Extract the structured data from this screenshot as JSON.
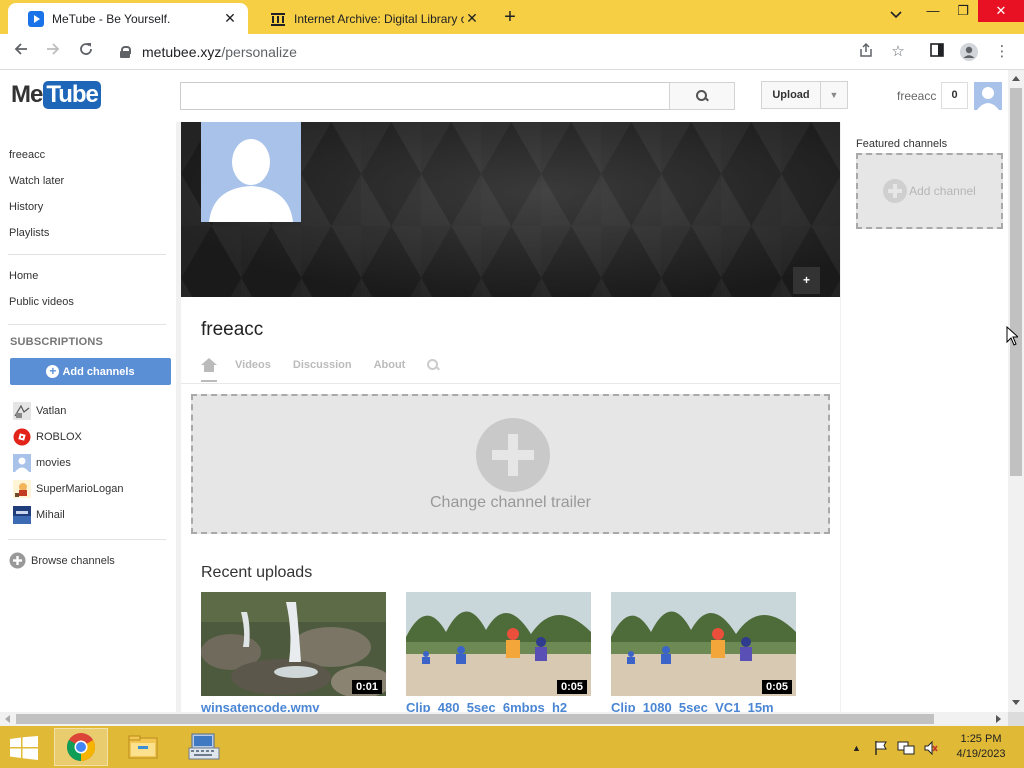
{
  "browser": {
    "tabs": [
      {
        "title": "MeTube - Be Yourself.",
        "active": true
      },
      {
        "title": "Internet Archive: Digital Library o",
        "active": false
      }
    ],
    "url_host": "metubee.xyz",
    "url_path": "/personalize"
  },
  "header": {
    "logo_me": "Me",
    "logo_tube": "Tube",
    "search_placeholder": "",
    "upload_label": "Upload",
    "username": "freeacc",
    "notification_count": "0"
  },
  "sidebar": {
    "top_items": [
      "freeacc",
      "Watch later",
      "History",
      "Playlists"
    ],
    "nav_items": [
      "Home",
      "Public videos"
    ],
    "subscriptions_heading": "SUBSCRIPTIONS",
    "add_channels_label": "Add channels",
    "subscriptions": [
      "Vatlan",
      "ROBLOX",
      "movies",
      "SuperMarioLogan",
      "Mihail"
    ],
    "browse_channels_label": "Browse channels"
  },
  "channel": {
    "name": "freeacc",
    "tabs": [
      "Videos",
      "Discussion",
      "About"
    ],
    "banner_edit_label": "+",
    "trailer_label": "Change channel trailer",
    "recent_uploads_title": "Recent uploads",
    "videos": [
      {
        "title": "winsatencode.wmv",
        "duration": "0:01"
      },
      {
        "title": "Clip_480_5sec_6mbps_h2",
        "duration": "0:05"
      },
      {
        "title": "Clip_1080_5sec_VC1_15m",
        "duration": "0:05"
      }
    ]
  },
  "right": {
    "featured_title": "Featured channels",
    "add_channel_label": "Add channel"
  },
  "taskbar": {
    "time": "1:25 PM",
    "date": "4/19/2023"
  },
  "colors": {
    "tabstrip": "#f6cf45",
    "taskbar": "#e0b937",
    "accent_blue": "#5b8fd5",
    "link_blue": "#4a86d4"
  }
}
